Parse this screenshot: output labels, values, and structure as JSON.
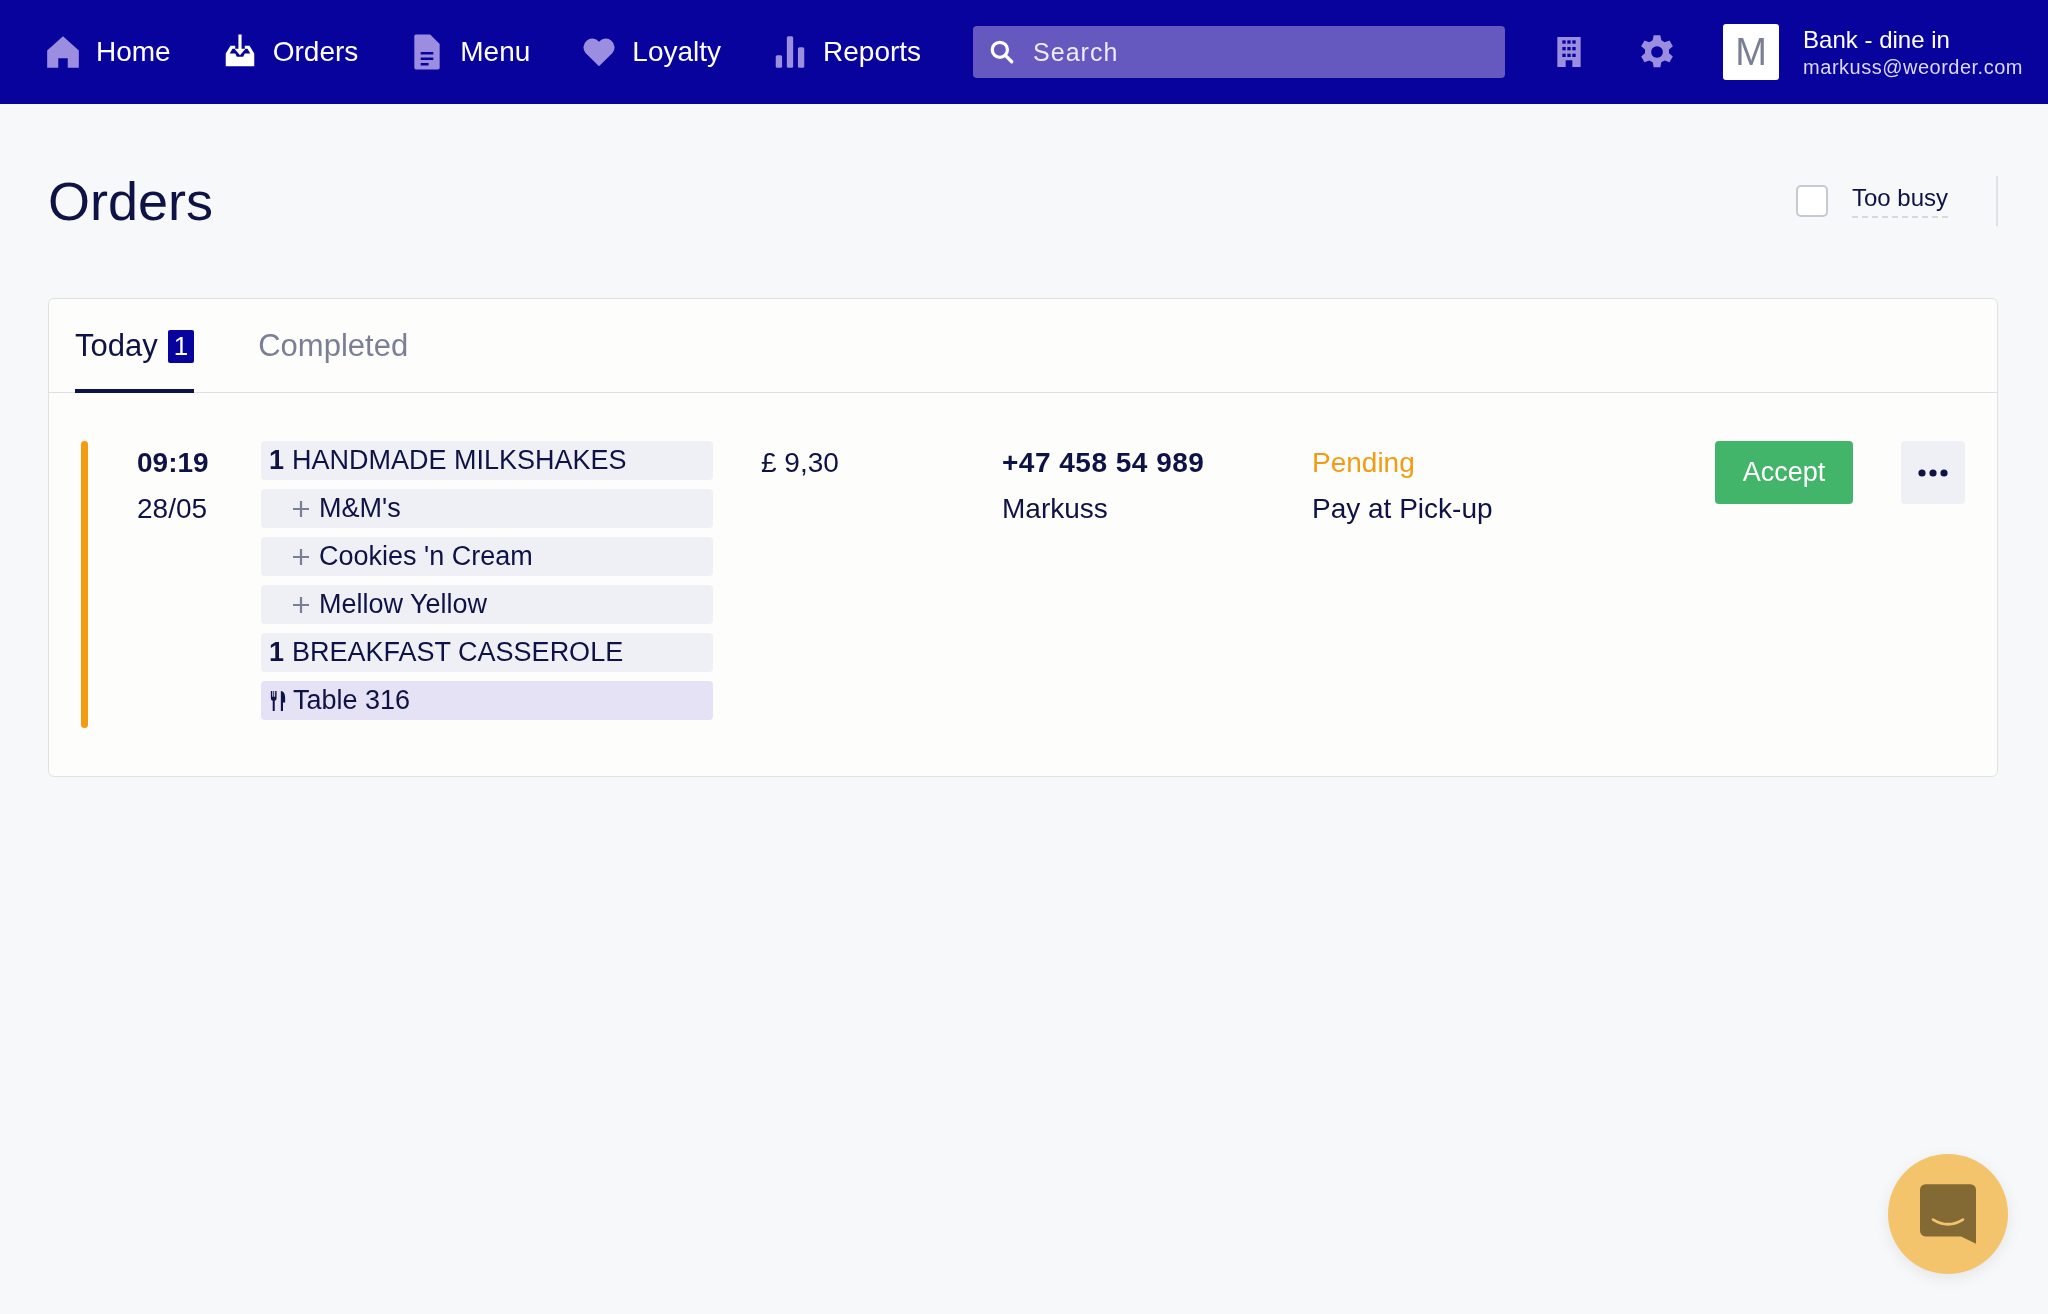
{
  "nav": {
    "items": [
      {
        "label": "Home",
        "selected": false
      },
      {
        "label": "Orders",
        "selected": true
      },
      {
        "label": "Menu",
        "selected": false
      },
      {
        "label": "Loyalty",
        "selected": false
      },
      {
        "label": "Reports",
        "selected": false
      }
    ],
    "search": {
      "placeholder": "Search"
    },
    "account": {
      "initial": "M",
      "name": "Bank - dine in",
      "email": "markuss@weorder.com"
    }
  },
  "page_title": "Orders",
  "too_busy": {
    "label": "Too busy",
    "checked": false
  },
  "tabs": [
    {
      "label": "Today",
      "badge": "1",
      "selected": true
    },
    {
      "label": "Completed",
      "selected": false
    }
  ],
  "orders": [
    {
      "time": "09:19",
      "date": "28/05",
      "color": "#f39c12",
      "items": [
        {
          "kind": "product",
          "qty": "1",
          "name": "HANDMADE MILKSHAKES"
        },
        {
          "kind": "option",
          "name": "M&M's"
        },
        {
          "kind": "option",
          "name": "Cookies 'n Cream"
        },
        {
          "kind": "option",
          "name": "Mellow Yellow"
        },
        {
          "kind": "product",
          "qty": "1",
          "name": "BREAKFAST CASSEROLE"
        },
        {
          "kind": "table",
          "name": "Table 316"
        }
      ],
      "price": "£ 9,30",
      "phone": "+47 458 54 989",
      "customer": "Markuss",
      "status": "Pending",
      "payment": "Pay at Pick-up",
      "action": "Accept"
    }
  ]
}
